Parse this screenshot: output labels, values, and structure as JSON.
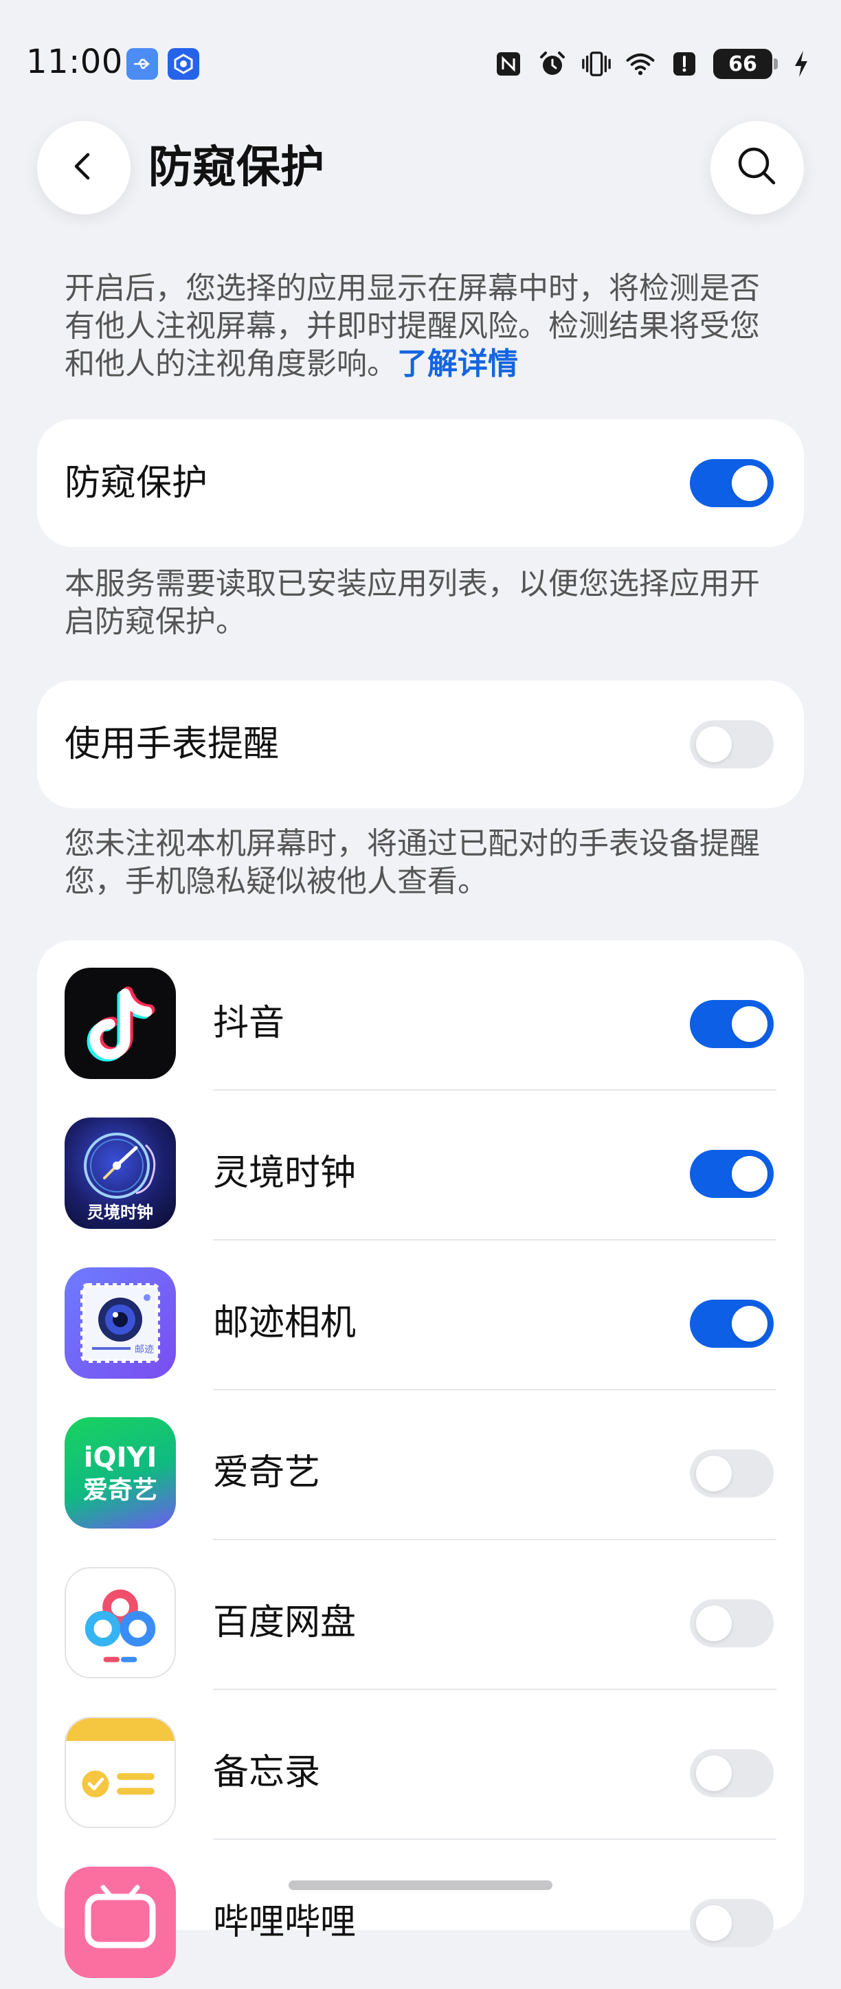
{
  "status_bar": {
    "time": "11:00",
    "battery": "66"
  },
  "header": {
    "title": "防窥保护",
    "back_icon": "chevron-left-icon",
    "search_icon": "search-icon"
  },
  "intro": {
    "text": "开启后，您选择的应用显示在屏幕中时，将检测是否有他人注视屏幕，并即时提醒风险。检测结果将受您和他人的注视角度影响。",
    "link": "了解详情"
  },
  "main_toggle": {
    "label": "防窥保护",
    "enabled": true
  },
  "main_note": "本服务需要读取已安装应用列表，以便您选择应用开启防窥保护。",
  "watch_toggle": {
    "label": "使用手表提醒",
    "enabled": false
  },
  "watch_note": "您未注视本机屏幕时，将通过已配对的手表设备提醒您，手机隐私疑似被他人查看。",
  "apps": [
    {
      "name": "抖音",
      "enabled": true,
      "icon": "douyin-icon"
    },
    {
      "name": "灵境时钟",
      "enabled": true,
      "icon": "lingjing-clock-icon",
      "icon_text": "灵境时钟"
    },
    {
      "name": "邮迹相机",
      "enabled": true,
      "icon": "youji-camera-icon",
      "icon_text": "邮迹"
    },
    {
      "name": "爱奇艺",
      "enabled": false,
      "icon": "iqiyi-icon",
      "icon_text": "iQIYI",
      "icon_text_2": "爱奇艺"
    },
    {
      "name": "百度网盘",
      "enabled": false,
      "icon": "baidu-netdisk-icon"
    },
    {
      "name": "备忘录",
      "enabled": false,
      "icon": "memo-icon"
    },
    {
      "name": "哔哩哔哩",
      "enabled": false,
      "icon": "bilibili-icon"
    }
  ],
  "colors": {
    "accent": "#0d5fe6",
    "background": "#f1f2f6",
    "card": "#ffffff",
    "link": "#1565e0"
  }
}
